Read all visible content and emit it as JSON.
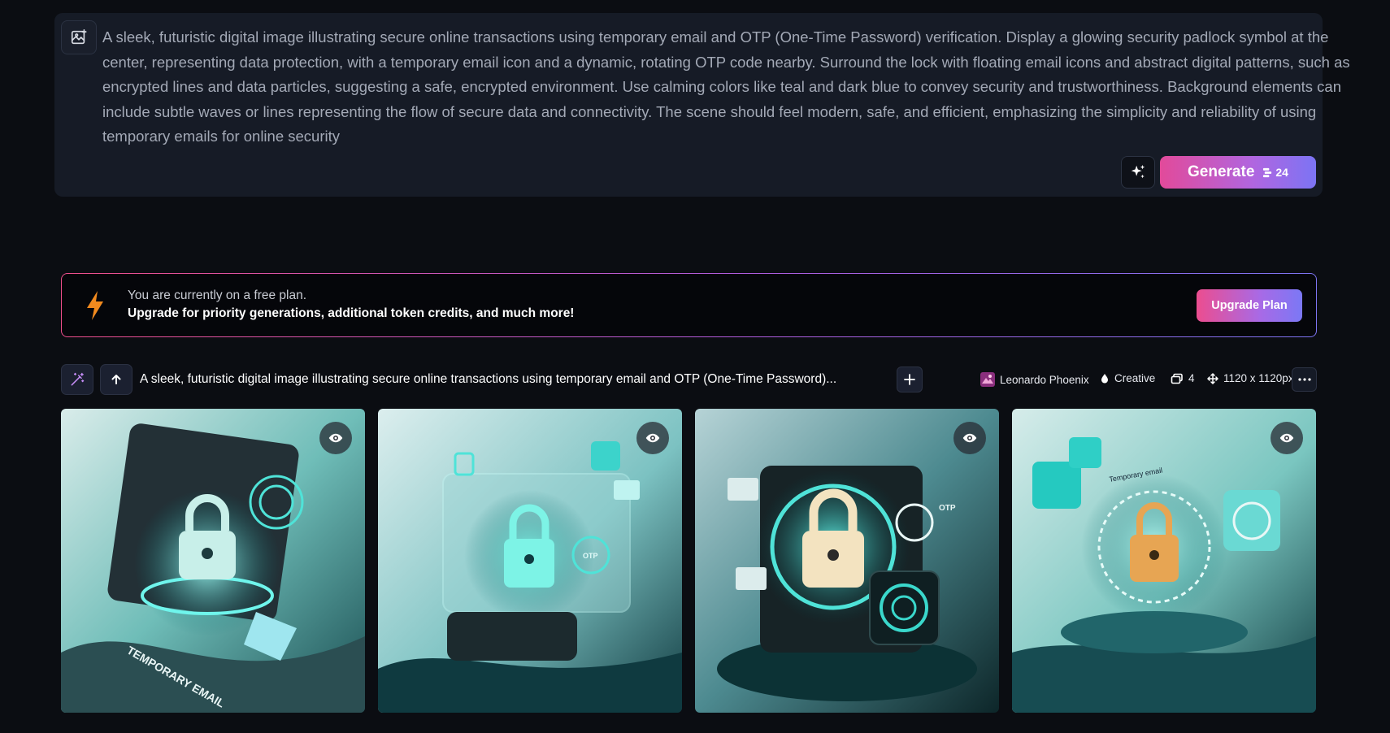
{
  "prompt": {
    "text": "A sleek, futuristic digital image illustrating secure online transactions using temporary email and OTP (One-Time Password) verification. Display a glowing security padlock symbol at the center, representing data protection, with a temporary email icon and a dynamic, rotating OTP code nearby. Surround the lock with floating email icons and abstract digital patterns, such as encrypted lines and data particles, suggesting a safe, encrypted environment. Use calming colors like teal and dark blue to convey security and trustworthiness. Background elements can include subtle waves or lines representing the flow of secure data and connectivity. The scene should feel modern, safe, and efficient, emphasizing the simplicity and reliability of using temporary emails for online security",
    "generate_label": "Generate",
    "token_cost": "24"
  },
  "banner": {
    "line1": "You are currently on a free plan.",
    "line2": "Upgrade for priority generations, additional token credits, and much more!",
    "button_label": "Upgrade Plan"
  },
  "generation": {
    "prompt_preview": "A sleek, futuristic digital image illustrating secure online transactions using temporary email and OTP (One-Time Password)...",
    "model": "Leonardo Phoenix",
    "style": "Creative",
    "image_count": "4",
    "dimensions": "1120 x 1120px"
  },
  "images": [
    {
      "caption_text": "TEMPORARY EMAIL",
      "lock_color": "#c8efe9"
    },
    {
      "caption_text": "OTP",
      "lock_color": "#7df3e6"
    },
    {
      "caption_text": "OTP",
      "lock_color": "#f3e3c0"
    },
    {
      "caption_text": "Temporary email",
      "lock_color": "#e7a553"
    }
  ],
  "colors": {
    "accent_pink": "#e24a9a",
    "accent_purple": "#7c74f4",
    "bolt_orange": "#f28a1e",
    "panel_bg": "#161b26"
  }
}
